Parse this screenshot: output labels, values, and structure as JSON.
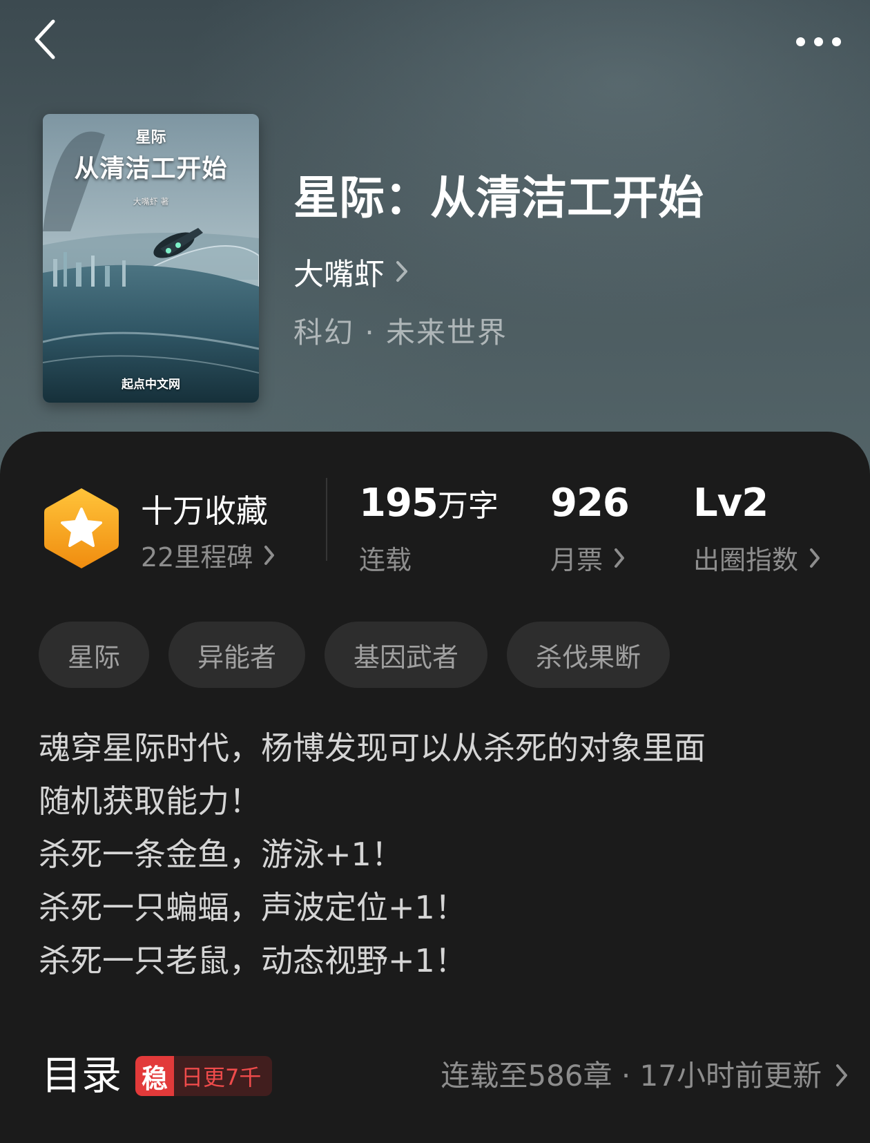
{
  "nav": {
    "back_icon": "chevron-left-icon",
    "more_icon": "more-horizontal-icon"
  },
  "book": {
    "title": "星际：从清洁工开始",
    "author": "大嘴虾",
    "genre": "科幻 · 未来世界",
    "cover": {
      "small_title": "星际",
      "big_title": "从清洁工开始",
      "author_line": "大嘴虾 著",
      "publisher": "起点中文网"
    }
  },
  "stats": {
    "collection": {
      "label": "十万收藏",
      "sub": "22里程碑",
      "icon": "star-badge-icon"
    },
    "words": {
      "number": "195",
      "unit": "万字",
      "sub": "连载"
    },
    "monthly_votes": {
      "number": "926",
      "sub": "月票"
    },
    "popularity": {
      "number": "Lv2",
      "sub": "出圈指数"
    }
  },
  "tags": [
    "星际",
    "异能者",
    "基因武者",
    "杀伐果断"
  ],
  "description": [
    "魂穿星际时代，杨博发现可以从杀死的对象里面",
    "随机获取能力！",
    "杀死一条金鱼，游泳+1！",
    "杀死一只蝙蝠，声波定位+1！",
    "杀死一只老鼠，动态视野+1！"
  ],
  "toc": {
    "title": "目录",
    "badge_icon": "稳",
    "badge_text": "日更7千",
    "status": "连载至586章 · 17小时前更新"
  },
  "colors": {
    "background": "#1b1b1b",
    "tag_bg": "#2d2d2d",
    "badge_orange": "#f7a21b",
    "accent_red": "#e23a3a"
  }
}
